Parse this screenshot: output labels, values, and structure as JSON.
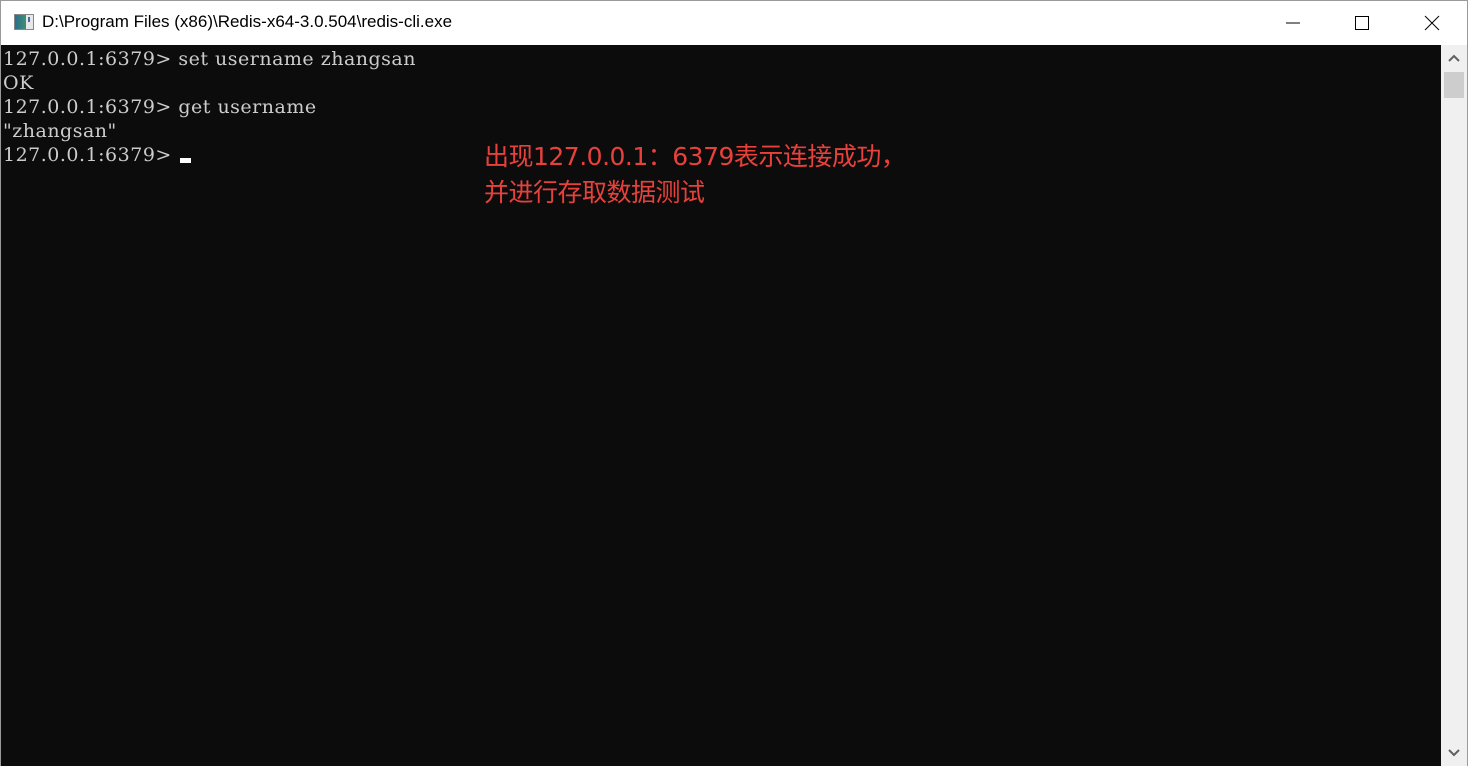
{
  "window": {
    "title": "D:\\Program Files (x86)\\Redis-x64-3.0.504\\redis-cli.exe",
    "icon": "console-app-icon",
    "controls": {
      "minimize": "minimize-icon",
      "maximize": "maximize-icon",
      "close": "close-icon"
    }
  },
  "console": {
    "lines": [
      "127.0.0.1:6379> set username zhangsan",
      "OK",
      "127.0.0.1:6379> get username",
      "\"zhangsan\"",
      "127.0.0.1:6379> "
    ],
    "text_color": "#cccccc",
    "background": "#0c0c0c"
  },
  "annotation": {
    "line1": "出现127.0.0.1：6379表示连接成功，",
    "line2": "并进行存取数据测试",
    "color": "#e8413b"
  },
  "scrollbar": {
    "up": "chevron-up-icon",
    "down": "chevron-down-icon",
    "position": 0
  }
}
